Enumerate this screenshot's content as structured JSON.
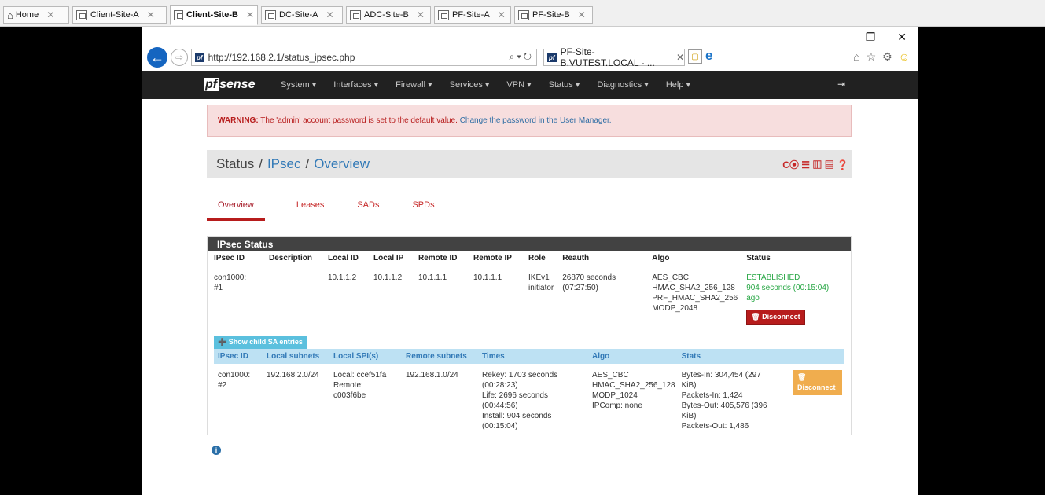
{
  "rdp_tabs": [
    {
      "label": "Home",
      "active": false
    },
    {
      "label": "Client-Site-A",
      "active": false
    },
    {
      "label": "Client-Site-B",
      "active": true
    },
    {
      "label": "DC-Site-A",
      "active": false
    },
    {
      "label": "ADC-Site-B",
      "active": false
    },
    {
      "label": "PF-Site-A",
      "active": false
    },
    {
      "label": "PF-Site-B",
      "active": false
    }
  ],
  "window_controls": {
    "minimize": "–",
    "restore": "❐",
    "close": "✕"
  },
  "browser": {
    "url": "http://192.168.2.1/status_ipsec.php",
    "search_glyph": "⌕ ▾ ↻",
    "tab_title": "PF-Site-B.VUTEST.LOCAL - ...",
    "tab_close": "✕",
    "favicon_text": "pf",
    "back_glyph": "←",
    "forward_glyph": "⇨",
    "ie_glyph": "e",
    "tools": {
      "home": "⌂",
      "star": "☆",
      "gear": "⚙",
      "smile": "☺"
    }
  },
  "nav": {
    "logo_pf": "pf",
    "logo_rest": "sense",
    "items": [
      "System ▾",
      "Interfaces ▾",
      "Firewall ▾",
      "Services ▾",
      "VPN ▾",
      "Status ▾",
      "Diagnostics ▾",
      "Help ▾"
    ],
    "logout_glyph": "⇥"
  },
  "warning": {
    "label": "WARNING:",
    "text": " The 'admin' account password is set to the default value. ",
    "link": "Change the password in the User Manager."
  },
  "breadcrumb": {
    "root": "Status",
    "sep": "/",
    "mid": "IPsec",
    "leaf": "Overview",
    "icons": "C⦿ ☰ ▥ ▤ ❓"
  },
  "subtabs": [
    "Overview",
    "Leases",
    "SADs",
    "SPDs"
  ],
  "panel_title": "IPsec Status",
  "ipsec_table": {
    "headers": [
      "IPsec ID",
      "Description",
      "Local ID",
      "Local IP",
      "Remote ID",
      "Remote IP",
      "Role",
      "Reauth",
      "Algo",
      "Status"
    ],
    "row": {
      "id_l1": "con1000:",
      "id_l2": "#1",
      "description": "",
      "local_id": "10.1.1.2",
      "local_ip": "10.1.1.2",
      "remote_id": "10.1.1.1",
      "remote_ip": "10.1.1.1",
      "role_l1": "IKEv1",
      "role_l2": "initiator",
      "reauth_l1": "26870 seconds",
      "reauth_l2": "(07:27:50)",
      "algo_l1": "AES_CBC",
      "algo_l2": "HMAC_SHA2_256_128",
      "algo_l3": "PRF_HMAC_SHA2_256",
      "algo_l4": "MODP_2048",
      "status_l1": "ESTABLISHED",
      "status_l2": "904 seconds (00:15:04)",
      "status_l3": "ago",
      "disconnect": "🗑 Disconnect"
    }
  },
  "child_button": "➕ Show child SA entries",
  "child_table": {
    "headers": [
      "IPsec ID",
      "Local subnets",
      "Local SPI(s)",
      "Remote subnets",
      "Times",
      "Algo",
      "Stats"
    ],
    "row": {
      "id_l1": "con1000:",
      "id_l2": "#2",
      "local_subnets": "192.168.2.0/24",
      "spi_l1": "Local: ccef51fa",
      "spi_l2": "Remote:",
      "spi_l3": "c003f6be",
      "remote_subnets": "192.168.1.0/24",
      "times_l1": "Rekey: 1703 seconds",
      "times_l2": "(00:28:23)",
      "times_l3": "Life: 2696 seconds",
      "times_l4": "(00:44:56)",
      "times_l5": "Install: 904 seconds",
      "times_l6": "(00:15:04)",
      "algo_l1": "AES_CBC",
      "algo_l2": "HMAC_SHA2_256_128",
      "algo_l3": "MODP_1024",
      "algo_l4": "IPComp: none",
      "stats_l1": "Bytes-In: 304,454 (297",
      "stats_l2": "KiB)",
      "stats_l3": "Packets-In: 1,424",
      "stats_l4": "Bytes-Out: 405,576 (396",
      "stats_l5": "KiB)",
      "stats_l6": "Packets-Out: 1,486",
      "disconnect": "🗑 Disconnect"
    }
  },
  "info_glyph": "i"
}
